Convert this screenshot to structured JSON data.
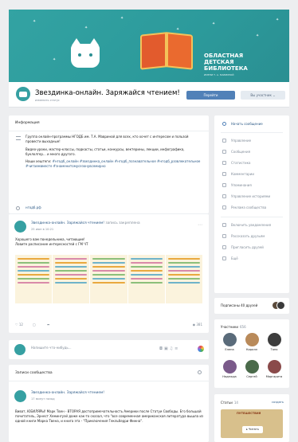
{
  "cover": {
    "title_line1": "ОБЛАСТНАЯ",
    "title_line2": "ДЕТСКАЯ",
    "title_line3": "БИБЛИОТЕКА",
    "subtitle": "ИМЕНИ Т. А. МАВРИНОЙ",
    "color": "#2c9a9b"
  },
  "profile": {
    "name": "Звездинка-онлайн. Заряжайся чтением!",
    "status": "изменить статус",
    "primary_button": "Перейти",
    "secondary_button": "Вы участник ⌄"
  },
  "info": {
    "header": "Информация",
    "paragraph1": "Группа онлайн-программы НГОДБ им. Т.А. Мавриной для всех, кто хочет с интересом и пользой провести выходные!",
    "paragraph2": "Видео-уроки, мастер-классы, подкасты, статьи, конкурсы, вектерины, лекции, инфографика, буклолгер... и много другого.",
    "paragraph3_label": "Наши хештеги:",
    "hashtags": "#нгодб_онлайн #звездинка_онлайн #нгодб_познавательное #нгодб_развлекательное #читаемвместе #знаменитомусезонувсемирно",
    "website": "нгодб.рф"
  },
  "post1": {
    "author": "Звездинка-онлайн. Заряжайся чтением!",
    "author_suffix": "запись закреплена",
    "date": "25 июн в 10:21",
    "text_line1": "Хорошего вам понедельника, читающие!",
    "text_line2": "Ловите расписание интересностей с ГМ ЧТ",
    "likes": "12",
    "views": "381"
  },
  "composer": {
    "placeholder": "Напишите что-нибудь..."
  },
  "wall": {
    "header": "Записи сообщества",
    "post_author": "Звездинка-онлайн. Заряжайся чтением!",
    "post_date": "17 минут назад",
    "post_text": "Виват, ЮБИЛЯРЫ! Марк Твен - ВТОРАЯ достопримечательность Америки после Статуи Свободы. Его большой почитатель, Эрнест Хемингуэй даже как-то сказал, что \"все современная американская литература вышла из одной книги Марка Твена, и книга эта - \"Приключения Гекльберри Финна\"."
  },
  "right_nav": {
    "items": [
      {
        "label": "Начать сообщение",
        "icon": "message-icon"
      },
      {
        "label": "Управление",
        "icon": "gear-icon"
      },
      {
        "label": "Сообщения",
        "icon": "chat-icon"
      },
      {
        "label": "Статистика",
        "icon": "stats-icon"
      },
      {
        "label": "Комментарии",
        "icon": "comment-icon"
      },
      {
        "label": "Упоминания",
        "icon": "mention-icon"
      },
      {
        "label": "Управление историями",
        "icon": "stories-icon"
      },
      {
        "label": "Реклама сообщества",
        "icon": "ads-icon"
      },
      {
        "label": "Включить уведомления",
        "icon": "bell-icon"
      },
      {
        "label": "Рассказать друзьям",
        "icon": "share-icon"
      },
      {
        "label": "Пригласить друзей",
        "icon": "invite-icon"
      },
      {
        "label": "Ещё",
        "icon": "more-icon"
      }
    ]
  },
  "friends": {
    "label": "Подписаны 40 друзей"
  },
  "members": {
    "header": "Участники",
    "count": "656",
    "people": [
      {
        "name": "Елена",
        "color": "#5a6b7a"
      },
      {
        "name": "Кирилл",
        "color": "#b98a5a"
      },
      {
        "name": "Таня",
        "color": "#3d3d3d"
      },
      {
        "name": "Надежда",
        "color": "#7a5a8a"
      },
      {
        "name": "Сергей",
        "color": "#4a6a4a"
      },
      {
        "name": "Маргарита",
        "color": "#8a4a4a"
      }
    ]
  },
  "articles": {
    "header": "Статьи",
    "count": "14",
    "create": "создать",
    "cover_title": "ПУТЕШЕСТВИЯ",
    "read_button": "Читать"
  }
}
